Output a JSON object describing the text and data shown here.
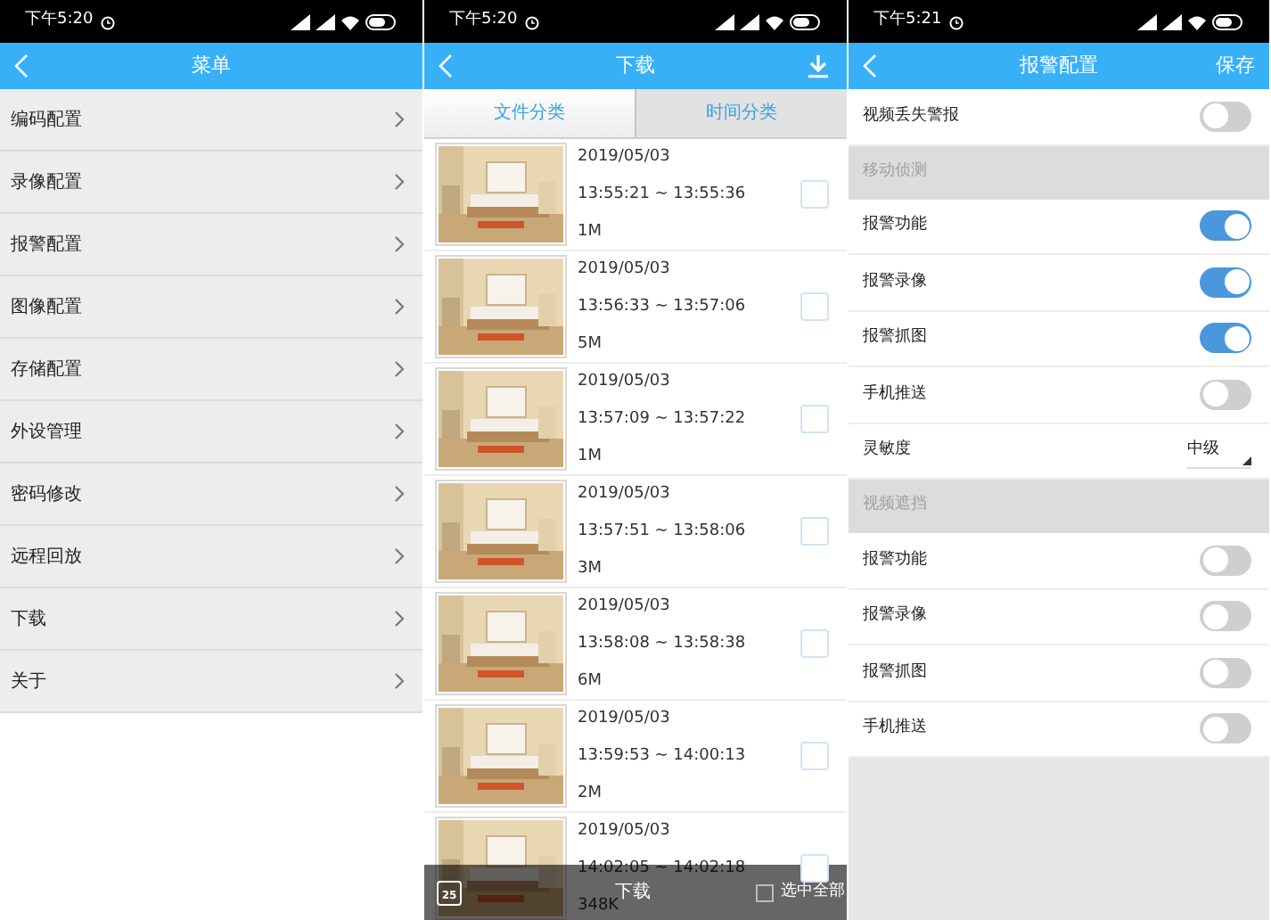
{
  "menu_screen": {
    "status_bar": {
      "time": "下午5:20"
    },
    "header": {
      "title": "菜单"
    },
    "items": [
      {
        "label": "编码配置"
      },
      {
        "label": "录像配置"
      },
      {
        "label": "报警配置"
      },
      {
        "label": "图像配置"
      },
      {
        "label": "存储配置"
      },
      {
        "label": "外设管理"
      },
      {
        "label": "密码修改"
      },
      {
        "label": "远程回放"
      },
      {
        "label": "下载"
      },
      {
        "label": "关于"
      }
    ]
  },
  "download_screen": {
    "status_bar": {
      "time": "下午5:20"
    },
    "header": {
      "title": "下载"
    },
    "tabs": [
      {
        "label": "文件分类",
        "selected": true
      },
      {
        "label": "时间分类",
        "selected": false
      }
    ],
    "files": [
      {
        "kind": "picture",
        "date": "2019/05/03",
        "time_range": "13:55:21 ~ 13:55:36",
        "size": "1M",
        "checked": false
      },
      {
        "kind": "picture",
        "date": "2019/05/03",
        "time_range": "13:56:33 ~ 13:57:06",
        "size": "5M",
        "checked": false
      },
      {
        "kind": "picture",
        "date": "2019/05/03",
        "time_range": "13:57:09 ~ 13:57:22",
        "size": "1M",
        "checked": false
      },
      {
        "kind": "picture",
        "date": "2019/05/03",
        "time_range": "13:57:51 ~ 13:58:06",
        "size": "3M",
        "checked": false
      },
      {
        "kind": "picture",
        "date": "2019/05/03",
        "time_range": "13:58:08 ~ 13:58:38",
        "size": "6M",
        "checked": false
      },
      {
        "kind": "picture",
        "date": "2019/05/03",
        "time_range": "13:59:53 ~ 14:00:13",
        "size": "2M",
        "checked": false
      },
      {
        "kind": "picture",
        "date": "2019/05/03",
        "time_range": "14:02:05 ~ 14:02:18",
        "size": "348K",
        "checked": false
      }
    ],
    "bottom_bar": {
      "calendar_day": "25",
      "download_label": "下载",
      "select_all": {
        "label": "选中全部",
        "checked": false
      }
    }
  },
  "alarm_screen": {
    "status_bar": {
      "time": "下午5:21"
    },
    "header": {
      "title": "报警配置",
      "action": "保存"
    },
    "rows": [
      {
        "kind": "toggle",
        "label": "视频丢失警报",
        "on": false
      },
      {
        "kind": "section",
        "label": "移动侦测"
      },
      {
        "kind": "toggle",
        "label": "报警功能",
        "on": true
      },
      {
        "kind": "toggle",
        "label": "报警录像",
        "on": true
      },
      {
        "kind": "toggle",
        "label": "报警抓图",
        "on": true
      },
      {
        "kind": "toggle",
        "label": "手机推送",
        "on": false
      },
      {
        "kind": "select",
        "label": "灵敏度",
        "value": "中级"
      },
      {
        "kind": "section",
        "label": "视频遮挡"
      },
      {
        "kind": "toggle",
        "label": "报警功能",
        "on": false
      },
      {
        "kind": "toggle",
        "label": "报警录像",
        "on": false
      },
      {
        "kind": "toggle",
        "label": "报警抓图",
        "on": false
      },
      {
        "kind": "toggle",
        "label": "手机推送",
        "on": false
      }
    ]
  }
}
